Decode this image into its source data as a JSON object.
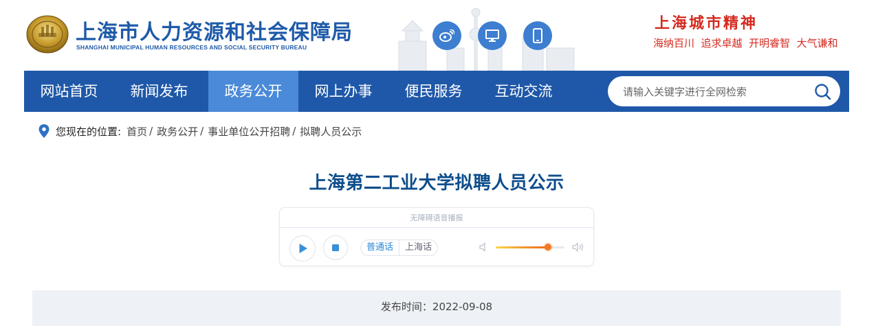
{
  "header": {
    "title": "上海市人力资源和社会保障局",
    "subtitle": "SHANGHAI MUNICIPAL HUMAN RESOURCES AND SOCIAL SECURITY BUREAU",
    "spirit_title": "上海城市精神",
    "spirit_motto": "海纳百川  追求卓越  开明睿智  大气谦和",
    "icons": [
      "weibo-icon",
      "desktop-icon",
      "mobile-icon"
    ]
  },
  "nav": {
    "items": [
      "网站首页",
      "新闻发布",
      "政务公开",
      "网上办事",
      "便民服务",
      "互动交流"
    ],
    "active": "政务公开",
    "search_placeholder": "请输入关键字进行全网检索"
  },
  "breadcrumb": {
    "label": "您现在的位置:",
    "items": [
      "首页",
      "政务公开",
      "事业单位公开招聘",
      "拟聘人员公示"
    ]
  },
  "article": {
    "title": "上海第二工业大学拟聘人员公示",
    "publish_time": "发布时间：2022-09-08"
  },
  "player": {
    "label": "无障碍语音播报",
    "languages": [
      "普通话",
      "上海话"
    ],
    "active_language": "普通话",
    "volume": 0.76
  },
  "colors": {
    "nav_bg": "#1f58a8",
    "nav_active": "#4a8ad8",
    "title_blue": "#0d4d8c",
    "spirit_red": "#d42a1f",
    "volume_orange": "#f27a22"
  }
}
